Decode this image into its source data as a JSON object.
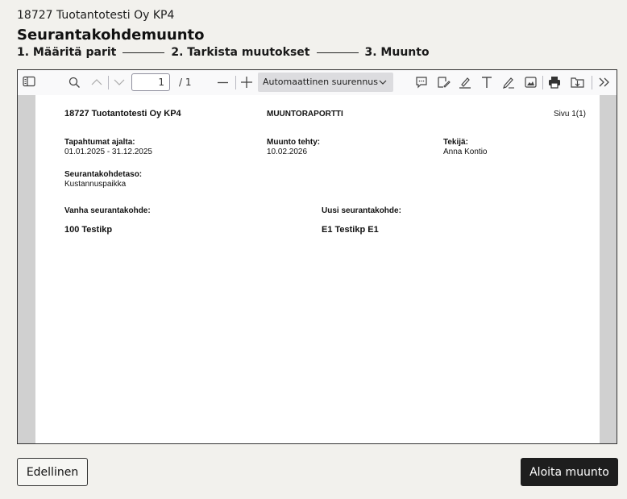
{
  "header": {
    "company": "18727 Tuotantotesti Oy KP4",
    "title": "Seurantakohdemuunto",
    "steps": [
      "1. Määritä parit",
      "2. Tarkista muutokset",
      "3. Muunto"
    ]
  },
  "viewer": {
    "toolbar": {
      "page_value": "1",
      "page_total": "/ 1",
      "zoom_label": "Automaattinen suurennus",
      "icons": [
        "sidebar-toggle-icon",
        "search-icon",
        "chevron-up-icon",
        "chevron-down-icon",
        "zoom-out-icon",
        "zoom-in-icon",
        "comment-icon",
        "signature-icon",
        "highlight-icon",
        "text-icon",
        "draw-icon",
        "image-icon",
        "print-icon",
        "download-icon",
        "more-tools-icon"
      ]
    },
    "report": {
      "company": "18727  Tuotantotesti Oy KP4",
      "report_title": "MUUNTORAPORTTI",
      "page_info": "Sivu 1(1)",
      "period_label": "Tapahtumat ajalta:",
      "period_value": "01.01.2025 - 31.12.2025",
      "done_label": "Muunto tehty:",
      "done_value": "10.02.2026",
      "author_label": "Tekijä:",
      "author_value": "Anna Kontio",
      "level_label": "Seurantakohdetaso:",
      "level_value": "Kustannuspaikka",
      "old_label": "Vanha seurantakohde:",
      "new_label": "Uusi seurantakohde:",
      "old_value": "100 Testikp",
      "new_value": "E1 Testikp E1"
    }
  },
  "footer": {
    "prev_label": "Edellinen",
    "start_label": "Aloita muunto"
  }
}
